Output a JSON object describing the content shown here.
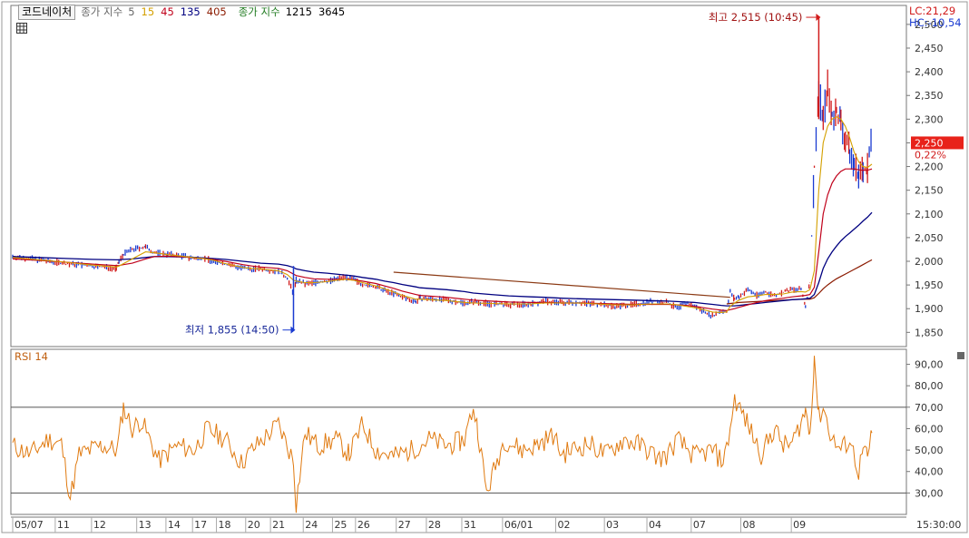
{
  "legend": {
    "code_button": "코드네이처",
    "price_ma_label": "종가 지수",
    "price_ma_periods": [
      {
        "value": "5",
        "color": "#666666"
      },
      {
        "value": "15",
        "color": "#d4a000"
      },
      {
        "value": "45",
        "color": "#c0001a"
      },
      {
        "value": "135",
        "color": "#000080"
      },
      {
        "value": "405",
        "color": "#8b1a00"
      }
    ],
    "vol_ma_label": "종가 지수",
    "vol_ma_periods": [
      {
        "value": "1215",
        "color": "#000000"
      },
      {
        "value": "3645",
        "color": "#000000"
      }
    ]
  },
  "top_right": {
    "lc": "LC:21,29",
    "hc": "HC:-10,54"
  },
  "rsi_label": "RSI 14",
  "time_label": "15:30:00",
  "colors": {
    "up": "#d11a1a",
    "down": "#1a3bd1",
    "ma5": "#666666",
    "ma15": "#d4a000",
    "ma45": "#c0001a",
    "ma135": "#000080",
    "ma405": "#8b1a00",
    "trendline": "#8b3a14",
    "rsi": "#e07a10",
    "price_badge": "#e8221a"
  },
  "chart_data": [
    {
      "type": "line",
      "name": "price",
      "yticks": [
        "2,500",
        "2,450",
        "2,400",
        "2,350",
        "2,300",
        "2,250",
        "2,200",
        "2,150",
        "2,100",
        "2,050",
        "2,000",
        "1,950",
        "1,900",
        "1,850"
      ],
      "ylim": [
        1820,
        2540
      ],
      "current_price": "2,250",
      "current_change": "0,22%",
      "high_annotation": "최고 2,515 (10:45)",
      "low_annotation": "최저 1,855 (14:50)",
      "x": [
        0,
        30,
        60,
        90,
        117,
        120,
        125,
        135,
        150,
        160,
        175,
        195,
        207,
        215,
        225,
        240,
        260,
        270,
        280,
        300,
        310,
        317,
        320,
        330,
        340,
        355,
        365,
        375,
        385,
        395,
        410,
        420,
        430,
        440,
        455,
        460,
        490,
        510,
        520,
        540,
        560,
        585,
        600,
        620,
        640,
        660,
        680,
        700,
        720,
        740,
        750,
        760,
        770,
        780,
        790,
        800,
        806,
        810,
        815,
        820,
        830,
        840,
        850,
        860,
        870,
        880,
        890,
        895,
        900,
        905,
        910,
        915,
        920,
        925,
        930,
        935,
        940,
        945,
        950,
        955,
        960,
        965,
        970
      ],
      "close": [
        2010,
        2003,
        1995,
        1990,
        1985,
        2000,
        2015,
        2025,
        2030,
        2018,
        2015,
        2010,
        2005,
        2008,
        2000,
        1995,
        1985,
        1983,
        1985,
        1978,
        1965,
        1930,
        1960,
        1952,
        1955,
        1958,
        1962,
        1968,
        1960,
        1952,
        1945,
        1938,
        1932,
        1925,
        1915,
        1922,
        1918,
        1912,
        1915,
        1910,
        1908,
        1910,
        1915,
        1913,
        1913,
        1910,
        1905,
        1908,
        1915,
        1913,
        1900,
        1912,
        1905,
        1895,
        1885,
        1895,
        1895,
        1935,
        1920,
        1925,
        1940,
        1928,
        1935,
        1928,
        1935,
        1940,
        1940,
        1905,
        1955,
        2200,
        2360,
        2300,
        2370,
        2305,
        2320,
        2290,
        2260,
        2230,
        2200,
        2185,
        2190,
        2200,
        2250
      ],
      "ma15": [
        2008,
        2003,
        1998,
        1992,
        1988,
        1990,
        1995,
        2005,
        2020,
        2018,
        2014,
        2010,
        2007,
        2006,
        2003,
        1995,
        1987,
        1985,
        1984,
        1980,
        1972,
        1960,
        1958,
        1955,
        1955,
        1957,
        1960,
        1962,
        1960,
        1955,
        1948,
        1942,
        1935,
        1928,
        1920,
        1920,
        1917,
        1913,
        1912,
        1911,
        1910,
        1910,
        1912,
        1912,
        1912,
        1910,
        1908,
        1908,
        1910,
        1910,
        1908,
        1905,
        1902,
        1898,
        1893,
        1892,
        1893,
        1905,
        1912,
        1918,
        1925,
        1927,
        1930,
        1930,
        1931,
        1935,
        1936,
        1935,
        1940,
        1980,
        2150,
        2250,
        2285,
        2300,
        2305,
        2300,
        2285,
        2260,
        2230,
        2210,
        2200,
        2198,
        2205
      ],
      "ma45": [
        2005,
        2002,
        1998,
        1994,
        1991,
        1991,
        1993,
        1996,
        2005,
        2010,
        2011,
        2009,
        2007,
        2006,
        2004,
        2000,
        1993,
        1990,
        1988,
        1985,
        1980,
        1973,
        1970,
        1966,
        1963,
        1962,
        1962,
        1962,
        1961,
        1958,
        1953,
        1948,
        1943,
        1937,
        1930,
        1928,
        1924,
        1920,
        1918,
        1916,
        1914,
        1913,
        1913,
        1912,
        1912,
        1911,
        1910,
        1909,
        1909,
        1909,
        1908,
        1907,
        1905,
        1902,
        1899,
        1897,
        1896,
        1898,
        1900,
        1903,
        1908,
        1913,
        1917,
        1920,
        1922,
        1925,
        1927,
        1928,
        1930,
        1945,
        2020,
        2100,
        2140,
        2165,
        2180,
        2190,
        2195,
        2195,
        2195,
        2193,
        2192,
        2192,
        2195
      ],
      "ma135": [
        2010,
        2008,
        2006,
        2004,
        2003,
        2003,
        2004,
        2005,
        2008,
        2010,
        2010,
        2009,
        2008,
        2007,
        2006,
        2004,
        2000,
        1998,
        1996,
        1994,
        1991,
        1987,
        1984,
        1980,
        1977,
        1975,
        1973,
        1971,
        1969,
        1966,
        1962,
        1958,
        1955,
        1951,
        1946,
        1944,
        1940,
        1936,
        1933,
        1930,
        1927,
        1925,
        1924,
        1922,
        1921,
        1920,
        1919,
        1918,
        1917,
        1916,
        1915,
        1914,
        1913,
        1911,
        1909,
        1907,
        1906,
        1906,
        1906,
        1907,
        1909,
        1911,
        1913,
        1915,
        1917,
        1919,
        1920,
        1921,
        1922,
        1930,
        1955,
        1985,
        2005,
        2020,
        2032,
        2043,
        2052,
        2060,
        2068,
        2076,
        2085,
        2093,
        2103
      ],
      "ma405": [
        null,
        null,
        null,
        null,
        null,
        null,
        null,
        null,
        null,
        null,
        null,
        null,
        null,
        null,
        null,
        null,
        null,
        null,
        null,
        null,
        null,
        null,
        null,
        null,
        null,
        null,
        null,
        null,
        null,
        null,
        null,
        null,
        null,
        null,
        null,
        null,
        null,
        null,
        null,
        null,
        null,
        null,
        null,
        null,
        null,
        null,
        null,
        null,
        null,
        null,
        null,
        null,
        null,
        null,
        null,
        null,
        1910,
        1911,
        1912,
        1913,
        1914,
        1915,
        1916,
        1917,
        1918,
        1919,
        1920,
        1920,
        1920,
        1923,
        1932,
        1942,
        1950,
        1957,
        1963,
        1968,
        1973,
        1978,
        1983,
        1988,
        1993,
        1998,
        2003
      ],
      "trendline": [
        [
          430,
          1977
        ],
        [
          810,
          1924
        ]
      ]
    },
    {
      "type": "line",
      "name": "rsi",
      "yticks": [
        "90,00",
        "80,00",
        "70,00",
        "60,00",
        "50,00",
        "40,00",
        "30,00"
      ],
      "ylim": [
        20,
        97
      ],
      "reference_lines": [
        70,
        30
      ],
      "x": [
        0,
        20,
        40,
        55,
        65,
        75,
        100,
        118,
        125,
        135,
        145,
        165,
        185,
        205,
        220,
        240,
        258,
        270,
        300,
        317,
        320,
        330,
        345,
        365,
        380,
        395,
        410,
        430,
        450,
        470,
        490,
        505,
        510,
        520,
        525,
        535,
        555,
        575,
        590,
        610,
        620,
        630,
        650,
        670,
        690,
        710,
        730,
        740,
        750,
        770,
        790,
        800,
        806,
        815,
        830,
        845,
        860,
        870,
        880,
        895,
        900,
        905,
        910,
        915,
        925,
        935,
        945,
        955,
        960,
        965,
        970
      ],
      "values": [
        52,
        48,
        55,
        53,
        28,
        48,
        52,
        50,
        70,
        60,
        64,
        45,
        52,
        50,
        60,
        55,
        44,
        50,
        62,
        45,
        25,
        58,
        52,
        55,
        48,
        62,
        50,
        47,
        50,
        55,
        52,
        54,
        55,
        70,
        60,
        30,
        55,
        50,
        52,
        57,
        48,
        50,
        53,
        48,
        55,
        52,
        46,
        48,
        55,
        47,
        50,
        45,
        50,
        74,
        62,
        48,
        60,
        52,
        53,
        68,
        58,
        94,
        65,
        70,
        55,
        50,
        55,
        40,
        50,
        46,
        58
      ]
    }
  ],
  "x_axis": {
    "labels": [
      "05/07",
      "11",
      "12",
      "13",
      "14",
      "17",
      "18",
      "20",
      "21",
      "24",
      "25",
      "26",
      "27",
      "28",
      "31",
      "06/01",
      "02",
      "03",
      "04",
      "07",
      "08",
      "09"
    ],
    "positions": [
      0,
      48,
      89,
      140,
      173,
      203,
      230,
      263,
      291,
      328,
      361,
      387,
      433,
      467,
      507,
      553,
      613,
      668,
      716,
      766,
      822,
      879
    ]
  }
}
